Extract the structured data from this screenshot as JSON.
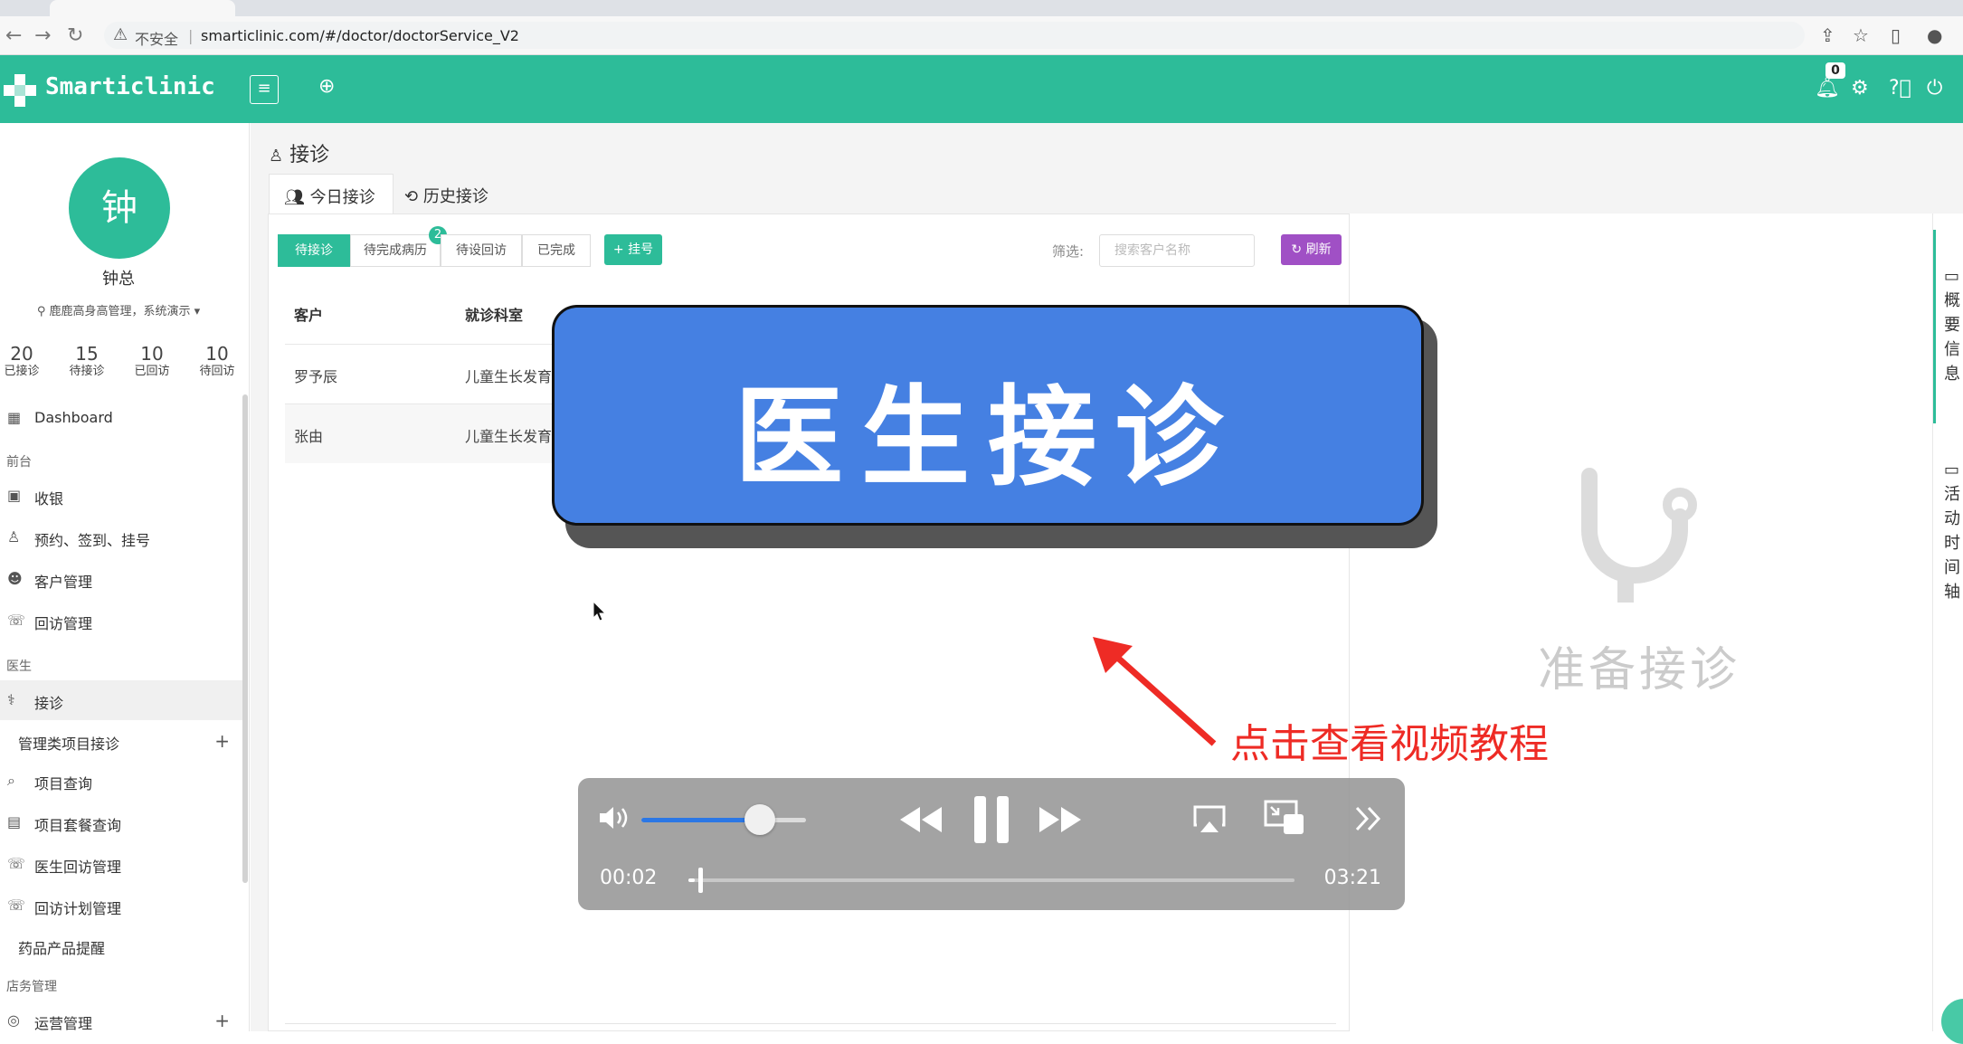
{
  "browser": {
    "security_label": "不安全",
    "url": "smarticlinic.com/#/doctor/doctorService_V2"
  },
  "app": {
    "brand": "Smarticlinic",
    "notification_count": "0",
    "accent_color": "#2dbc99"
  },
  "user": {
    "avatar_char": "钟",
    "name": "钟总",
    "org": "鹿鹿高身高管理，系统演示"
  },
  "stats": [
    {
      "value": "20",
      "label": "已接诊"
    },
    {
      "value": "15",
      "label": "待接诊"
    },
    {
      "value": "10",
      "label": "已回访"
    },
    {
      "value": "10",
      "label": "待回访"
    }
  ],
  "sidebar": {
    "dashboard": "Dashboard",
    "group_front": "前台",
    "cashier": "收银",
    "appointment": "预约、签到、挂号",
    "customers": "客户管理",
    "followup": "回访管理",
    "group_doctor": "医生",
    "consult": "接诊",
    "mgmt_project_consult": "管理类项目接诊",
    "project_query": "项目查询",
    "package_query": "项目套餐查询",
    "doctor_followup": "医生回访管理",
    "followup_plan": "回访计划管理",
    "drug_reminder": "药品产品提醒",
    "group_store": "店务管理",
    "operations": "运营管理"
  },
  "page": {
    "title": "接诊",
    "tab_today": "今日接诊",
    "tab_history": "历史接诊"
  },
  "filters": {
    "waiting": "待接诊",
    "pending_record": "待完成病历",
    "pending_record_count": "2",
    "pending_followup": "待设回访",
    "done": "已完成",
    "register": "+ 挂号",
    "filter_label": "筛选:",
    "search_placeholder": "搜索客户名称",
    "refresh": "刷新"
  },
  "table": {
    "headers": [
      "客户",
      "就诊科室"
    ],
    "rows": [
      {
        "customer": "罗予辰",
        "dept": "儿童生长发育"
      },
      {
        "customer": "张由",
        "dept": "儿童生长发育"
      }
    ]
  },
  "right_panel": {
    "ready_text": "准备接诊",
    "side_tab_1": "概要信息",
    "side_tab_2": "活动时间轴"
  },
  "overlay": {
    "banner_text": "医生接诊",
    "annotation": "点击查看视频教程",
    "banner_color": "#4580e2",
    "annotation_color": "#ee2b25"
  },
  "video": {
    "current_time": "00:02",
    "total_time": "03:21",
    "volume_fraction": 0.72,
    "progress_fraction": 0.01
  }
}
